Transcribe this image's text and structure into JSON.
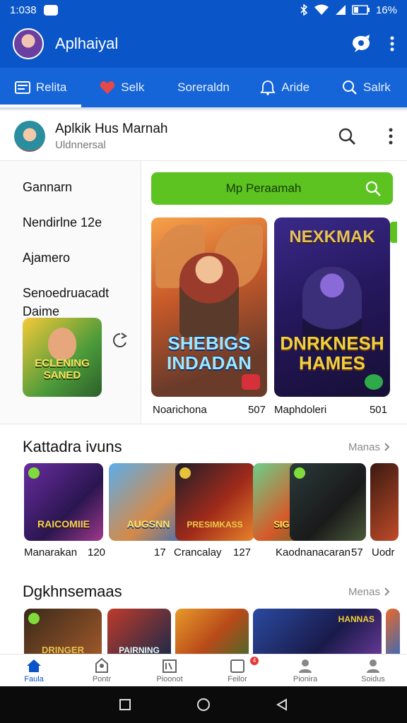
{
  "status": {
    "time": "1:038",
    "battery": "16%"
  },
  "appbar": {
    "title": "Aplhaiyal"
  },
  "tabs": [
    {
      "label": "Relita",
      "icon": "list-icon",
      "active": true
    },
    {
      "label": "Selk",
      "icon": "heart-icon"
    },
    {
      "label": "Soreraldn"
    },
    {
      "label": "Aride",
      "icon": "bell-icon"
    },
    {
      "label": "Salrk",
      "icon": "search-icon"
    }
  ],
  "profile": {
    "name": "Aplkik Hus Marnah",
    "subtitle": "Uldnnersal"
  },
  "sidebar": {
    "items": [
      "Gannarn",
      "Nendirlne 12e",
      "Ajamero",
      "Senoedruacadt",
      "Daime"
    ],
    "thumb_label": "ECLENING SANED"
  },
  "search_button": {
    "label": "Mp Peraamah"
  },
  "featured": [
    {
      "title": "SHEBIGS INDADAN",
      "caption": "Noarichona",
      "count": "507"
    },
    {
      "title": "DNRKNESH HAMES",
      "top_title": "NEXKMAK",
      "caption": "Maphdoleri",
      "count": "501"
    }
  ],
  "section1": {
    "title": "Kattadra ivuns",
    "more_label": "Manas",
    "thumbs": [
      {
        "label": "RAICOMIIE"
      },
      {
        "label": "AUGSNN"
      },
      {
        "label": "PRESIMKASS"
      },
      {
        "label": "SIGRINE"
      },
      {
        "label": ""
      },
      {
        "label": ""
      }
    ],
    "captions": [
      {
        "text": "Manarakan"
      },
      {
        "text": "120"
      },
      {
        "text": "17"
      },
      {
        "text": "Crancalay"
      },
      {
        "text": "127"
      },
      {
        "text": "Kaodnanacaran"
      },
      {
        "text": "57"
      },
      {
        "text": "Uodr"
      }
    ]
  },
  "section2": {
    "title": "Dgkhnsemaas",
    "more_label": "Menas",
    "thumbs": [
      {
        "label": "DRINGER"
      },
      {
        "label": "PAIRNING"
      },
      {
        "label": ""
      },
      {
        "label": "HANNAS"
      },
      {
        "label": ""
      }
    ]
  },
  "bottom_nav": [
    {
      "label": "Faula",
      "icon": "home-icon",
      "active": true
    },
    {
      "label": "Pontr",
      "icon": "store-icon"
    },
    {
      "label": "Pioonot",
      "icon": "library-icon"
    },
    {
      "label": "Feilor",
      "icon": "notification-icon",
      "badge": "4"
    },
    {
      "label": "Pionira",
      "icon": "person-icon"
    },
    {
      "label": "Soidus",
      "icon": "account-icon"
    }
  ],
  "colors": {
    "primary": "#0a56c8",
    "tabbar": "#1565d8",
    "accent_green": "#5cc320"
  }
}
